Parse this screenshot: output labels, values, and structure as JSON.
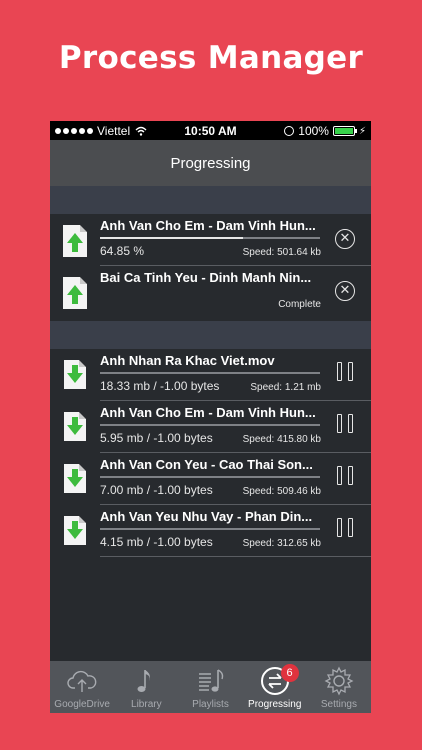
{
  "headline": "Process Manager",
  "statusbar": {
    "carrier": "Viettel",
    "time": "10:50 AM",
    "battery": "100%"
  },
  "navbar": {
    "title": "Progressing"
  },
  "active_tasks": [
    {
      "title": "Anh Van Cho Em - Dam Vinh Hun...",
      "progress_text": "64.85 %",
      "progress": 0.6485,
      "speed": "Speed: 501.64 kb",
      "icon": "upload-file-icon",
      "action": "close-icon"
    },
    {
      "title": "Bai Ca Tinh Yeu - Dinh Manh Nin...",
      "status": "Complete",
      "icon": "upload-file-icon",
      "action": "close-icon"
    }
  ],
  "queued_tasks": [
    {
      "title": "Anh Nhan Ra  Khac Viet.mov",
      "size": "18.33 mb / -1.00 bytes",
      "speed": "Speed: 1.21 mb",
      "progress": 0,
      "icon": "download-file-icon",
      "action": "pause-icon"
    },
    {
      "title": "Anh Van Cho Em - Dam Vinh Hun...",
      "size": "5.95 mb / -1.00 bytes",
      "speed": "Speed: 415.80 kb",
      "progress": 0,
      "icon": "download-file-icon",
      "action": "pause-icon"
    },
    {
      "title": "Anh Van Con Yeu - Cao Thai Son...",
      "size": "7.00 mb / -1.00 bytes",
      "speed": "Speed: 509.46 kb",
      "progress": 0,
      "icon": "download-file-icon",
      "action": "pause-icon"
    },
    {
      "title": "Anh Van Yeu Nhu Vay - Phan Din...",
      "size": "4.15 mb / -1.00 bytes",
      "speed": "Speed: 312.65 kb",
      "progress": 0,
      "icon": "download-file-icon",
      "action": "pause-icon"
    }
  ],
  "tabbar": {
    "tabs": [
      {
        "label": "GoogleDrive",
        "icon": "cloud-upload-icon",
        "active": false
      },
      {
        "label": "Library",
        "icon": "music-note-icon",
        "active": false
      },
      {
        "label": "Playlists",
        "icon": "playlist-icon",
        "active": false
      },
      {
        "label": "Progressing",
        "icon": "transfer-arrows-icon",
        "active": true,
        "badge": "6"
      },
      {
        "label": "Settings",
        "icon": "gear-icon",
        "active": false
      }
    ]
  },
  "colors": {
    "background": "#e94553",
    "screen": "#272a2e",
    "navbar": "#4b4d50",
    "section": "#3a3f4a",
    "tabbar": "#52555a",
    "progress_green": "#3dbb3d",
    "badge": "#e0333e"
  }
}
